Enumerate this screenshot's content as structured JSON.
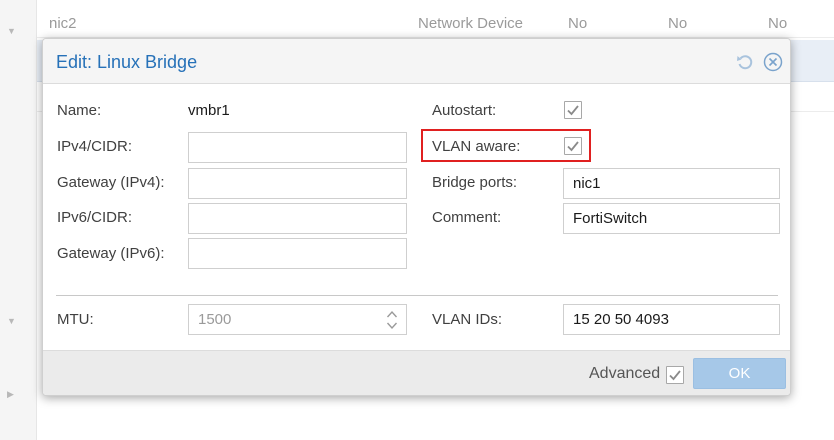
{
  "background": {
    "row_top": {
      "name": "nic2",
      "type": "Network Device",
      "col_a": "No",
      "col_b": "No",
      "col_c": "No"
    }
  },
  "dialog": {
    "title": "Edit: Linux Bridge",
    "icons": {
      "reset": "reset-icon",
      "close": "close-icon",
      "spinner": "spinner-arrows-icon",
      "checkmark": "checkmark-icon"
    },
    "left": {
      "name_label": "Name:",
      "name_value": "vmbr1",
      "ipv4_label": "IPv4/CIDR:",
      "ipv4_value": "",
      "gw4_label": "Gateway (IPv4):",
      "gw4_value": "",
      "ipv6_label": "IPv6/CIDR:",
      "ipv6_value": "",
      "gw6_label": "Gateway (IPv6):",
      "gw6_value": "",
      "mtu_label": "MTU:",
      "mtu_value": "1500"
    },
    "right": {
      "autostart_label": "Autostart:",
      "autostart_checked": true,
      "vlan_aware_label": "VLAN aware:",
      "vlan_aware_checked": true,
      "bridge_ports_label": "Bridge ports:",
      "bridge_ports_value": "nic1",
      "comment_label": "Comment:",
      "comment_value": "FortiSwitch",
      "vlan_ids_label": "VLAN IDs:",
      "vlan_ids_value": "15 20 50 4093"
    },
    "footer": {
      "advanced_label": "Advanced",
      "advanced_checked": true,
      "ok_label": "OK"
    }
  },
  "colors": {
    "title": "#2671b8",
    "highlight": "#e02020",
    "ok_button": "#a6c8e8"
  }
}
